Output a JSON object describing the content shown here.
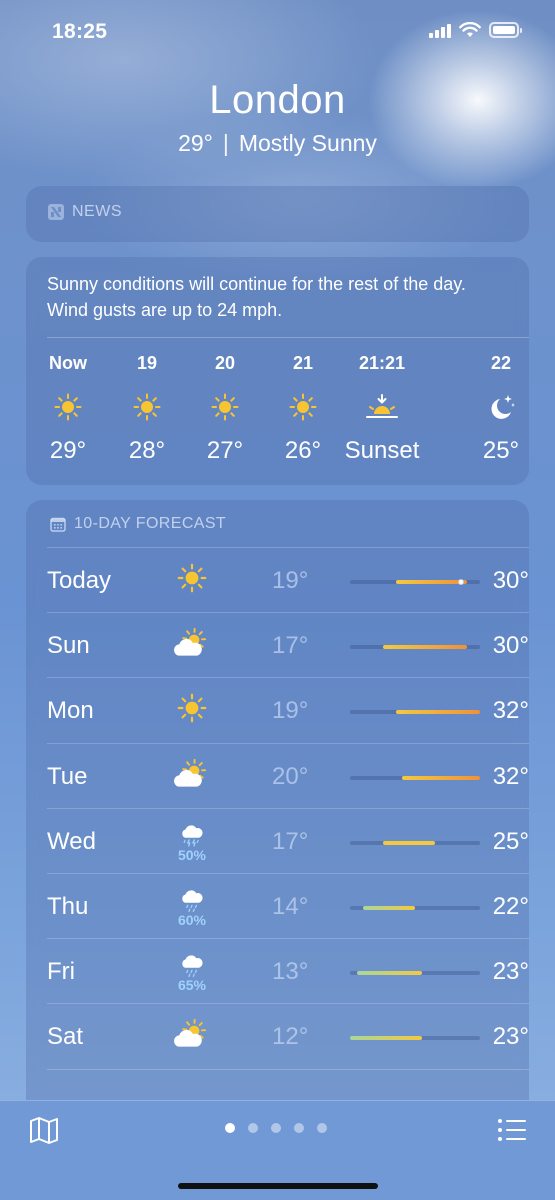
{
  "status_bar": {
    "time": "18:25"
  },
  "header": {
    "city": "London",
    "current_temp": "29°",
    "separator": "|",
    "condition": "Mostly Sunny"
  },
  "news": {
    "label": "NEWS"
  },
  "hourly": {
    "summary": "Sunny conditions will continue for the rest of the day. Wind gusts are up to 24 mph.",
    "items": [
      {
        "label": "Now",
        "icon": "sun-icon",
        "value": "29°"
      },
      {
        "label": "19",
        "icon": "sun-icon",
        "value": "28°"
      },
      {
        "label": "20",
        "icon": "sun-icon",
        "value": "27°"
      },
      {
        "label": "21",
        "icon": "sun-icon",
        "value": "26°"
      },
      {
        "label": "21:21",
        "icon": "sunset-icon",
        "value": "Sunset"
      },
      {
        "label": "22",
        "icon": "moon-stars-icon",
        "value": "25°"
      }
    ]
  },
  "forecast": {
    "label": "10-DAY FORECAST",
    "days": [
      {
        "day": "Today",
        "icon": "sun-icon",
        "precip": "",
        "low": "19°",
        "high": "30°",
        "range_low": 19,
        "range_high": 30,
        "current": 29
      },
      {
        "day": "Sun",
        "icon": "partly-cloudy-icon",
        "precip": "",
        "low": "17°",
        "high": "30°",
        "range_low": 17,
        "range_high": 30
      },
      {
        "day": "Mon",
        "icon": "sun-icon",
        "precip": "",
        "low": "19°",
        "high": "32°",
        "range_low": 19,
        "range_high": 32
      },
      {
        "day": "Tue",
        "icon": "partly-cloudy-icon",
        "precip": "",
        "low": "20°",
        "high": "32°",
        "range_low": 20,
        "range_high": 32
      },
      {
        "day": "Wed",
        "icon": "thunderstorm-icon",
        "precip": "50%",
        "low": "17°",
        "high": "25°",
        "range_low": 17,
        "range_high": 25
      },
      {
        "day": "Thu",
        "icon": "rain-cloud-icon",
        "precip": "60%",
        "low": "14°",
        "high": "22°",
        "range_low": 14,
        "range_high": 22
      },
      {
        "day": "Fri",
        "icon": "rain-cloud-icon",
        "precip": "65%",
        "low": "13°",
        "high": "23°",
        "range_low": 13,
        "range_high": 23
      },
      {
        "day": "Sat",
        "icon": "partly-cloudy-icon",
        "precip": "",
        "low": "12°",
        "high": "23°",
        "range_low": 12,
        "range_high": 23
      }
    ],
    "scale_min": 12,
    "scale_max": 32
  },
  "bottom_bar": {
    "page_count": 5,
    "active_page": 1
  },
  "colors": {
    "sun": "#f7c531",
    "precip": "#9fd2ff",
    "bar_warm": "#f0913a",
    "bar_mild": "#f3c940",
    "bar_cool": "#a9d79a"
  }
}
